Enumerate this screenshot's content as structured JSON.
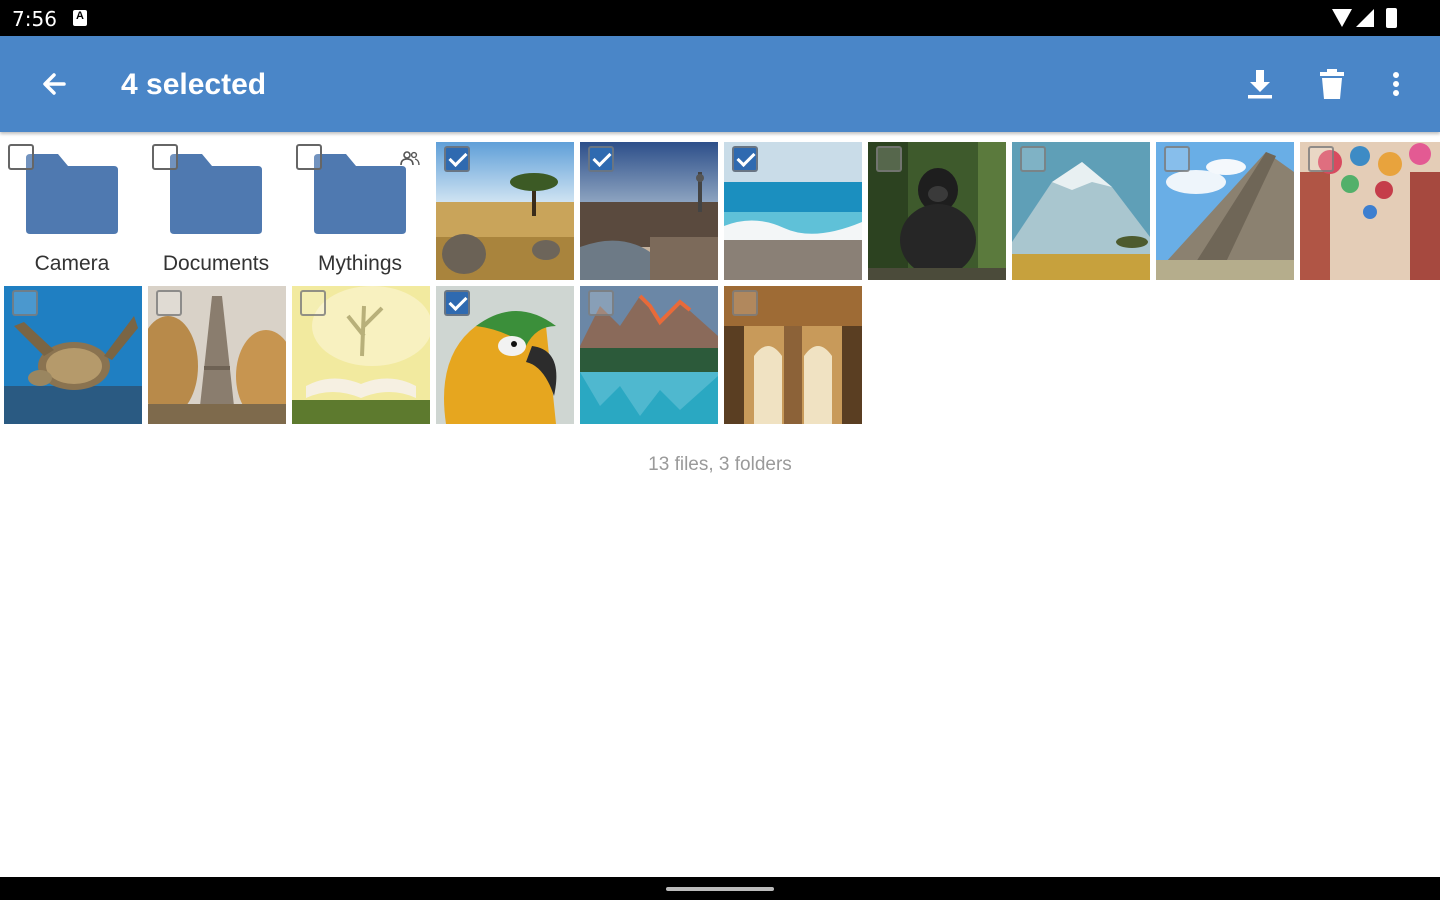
{
  "status_bar": {
    "time": "7:56",
    "icons": [
      "notification-a-icon",
      "wifi-icon",
      "signal-icon",
      "battery-icon"
    ]
  },
  "app_bar": {
    "title": "4 selected",
    "color": "#4a86c8",
    "actions": [
      "arrow-back-icon",
      "download-icon",
      "delete-icon",
      "more-vert-icon"
    ]
  },
  "folders": [
    {
      "name": "Camera",
      "selected": false,
      "shared": false
    },
    {
      "name": "Documents",
      "selected": false,
      "shared": false
    },
    {
      "name": "Mythings",
      "selected": false,
      "shared": true
    }
  ],
  "photos": [
    {
      "subject": "savanna-elephants",
      "selected": true
    },
    {
      "subject": "city-river-sunset",
      "selected": true
    },
    {
      "subject": "ocean-beach",
      "selected": true
    },
    {
      "subject": "gorilla",
      "selected": false
    },
    {
      "subject": "mountain-plain",
      "selected": false
    },
    {
      "subject": "pyramid-temple",
      "selected": false
    },
    {
      "subject": "umbrella-street",
      "selected": false
    },
    {
      "subject": "sea-turtle",
      "selected": false
    },
    {
      "subject": "eiffel-tower-autumn",
      "selected": false
    },
    {
      "subject": "open-book",
      "selected": false
    },
    {
      "subject": "macaw-parrot",
      "selected": true
    },
    {
      "subject": "mountain-lake",
      "selected": false
    },
    {
      "subject": "arched-palace",
      "selected": false
    }
  ],
  "footer": {
    "count_text": "13 files, 3 folders"
  },
  "colors": {
    "accent": "#4a86c8",
    "folder": "#4f79b0",
    "checkbox_on": "#2f6ab0"
  }
}
